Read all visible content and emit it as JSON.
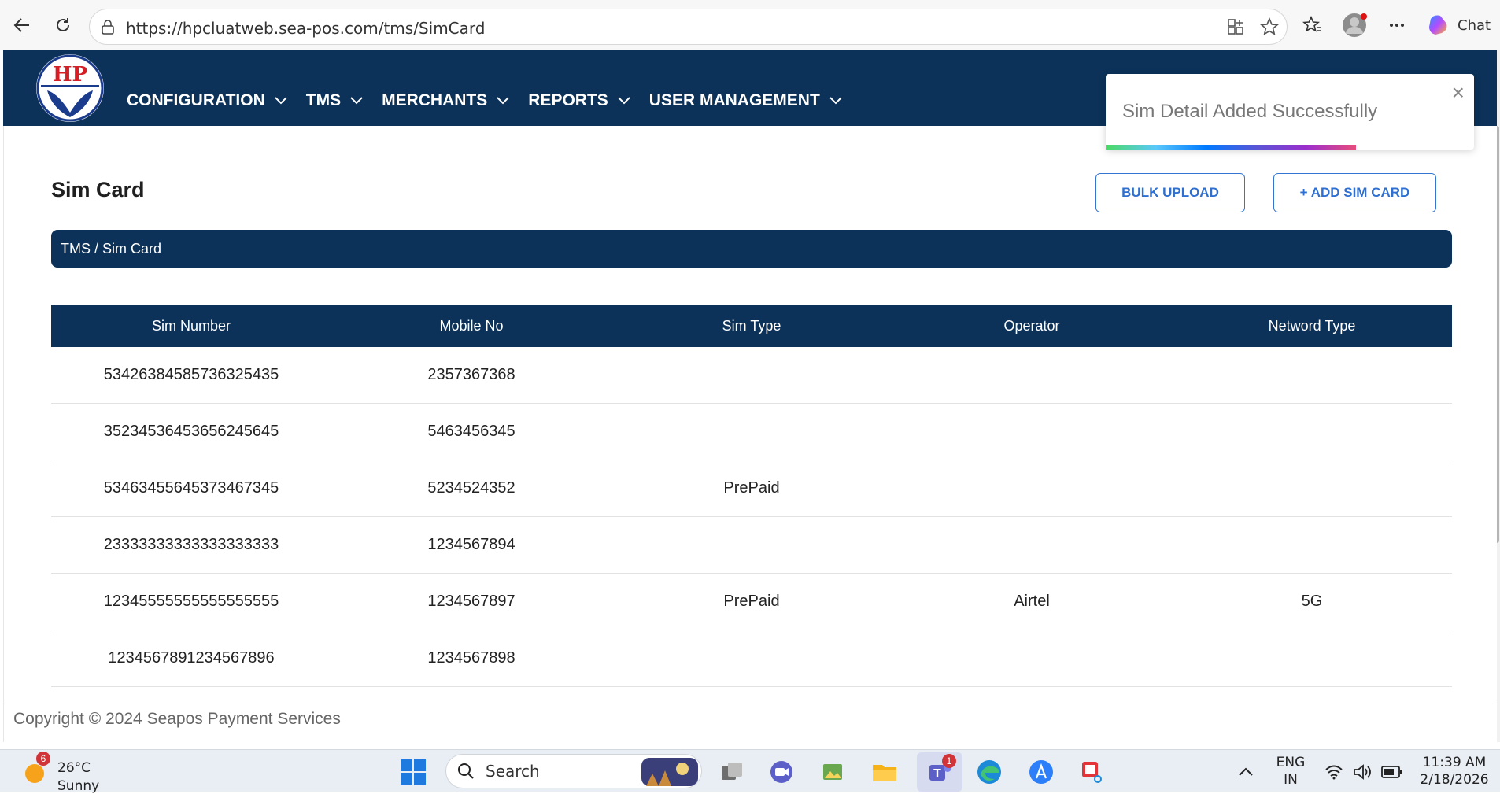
{
  "browser": {
    "url": "https://hpcluatweb.sea-pos.com/tms/SimCard",
    "chat_label": "Chat"
  },
  "header": {
    "logo_text": "HP",
    "menu": [
      {
        "label": "CONFIGURATION"
      },
      {
        "label": "TMS"
      },
      {
        "label": "MERCHANTS"
      },
      {
        "label": "REPORTS"
      },
      {
        "label": "USER MANAGEMENT"
      }
    ]
  },
  "toast": {
    "message": "Sim Detail Added Successfully",
    "close": "×",
    "progress": 0.68
  },
  "page": {
    "title": "Sim Card",
    "bulk_upload": "BULK UPLOAD",
    "add_sim": "+ ADD SIM CARD",
    "breadcrumb": "TMS / Sim Card"
  },
  "table": {
    "columns": [
      "Sim Number",
      "Mobile No",
      "Sim Type",
      "Operator",
      "Netword Type"
    ],
    "rows": [
      [
        "53426384585736325435",
        "2357367368",
        "",
        "",
        ""
      ],
      [
        "35234536453656245645",
        "5463456345",
        "",
        "",
        ""
      ],
      [
        "53463455645373467345",
        "5234524352",
        "PrePaid",
        "",
        ""
      ],
      [
        "23333333333333333333",
        "1234567894",
        "",
        "",
        ""
      ],
      [
        "12345555555555555555",
        "1234567897",
        "PrePaid",
        "Airtel",
        "5G"
      ],
      [
        "1234567891234567896",
        "1234567898",
        "",
        "",
        ""
      ]
    ]
  },
  "footer": {
    "copyright": "Copyright © 2024 Seapos Payment Services"
  },
  "taskbar": {
    "weather_badge": "6",
    "temperature": "26°C",
    "weather": "Sunny",
    "search_placeholder": "Search",
    "teams_badge": "1",
    "lang_top": "ENG",
    "lang_bottom": "IN",
    "time": "11:39 AM",
    "date": "2/18/2026"
  },
  "colors": {
    "nav": "#0c3259",
    "accent": "#2f6fd0"
  }
}
